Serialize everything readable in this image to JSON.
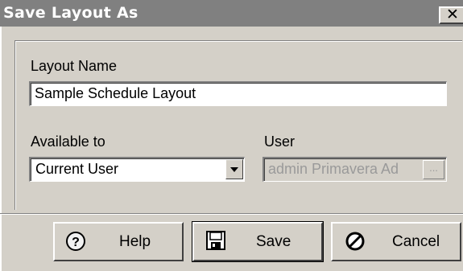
{
  "dialog": {
    "title": "Save Layout As",
    "close_glyph": "✕"
  },
  "form": {
    "layout_name_label": "Layout Name",
    "layout_name_value": "Sample Schedule Layout",
    "available_to_label": "Available to",
    "available_to_value": "Current User",
    "user_label": "User",
    "user_value": "admin  Primavera Ad",
    "user_browse_label": "..."
  },
  "buttons": {
    "help": {
      "label": "Help",
      "icon": "help-icon"
    },
    "save": {
      "label": "Save",
      "icon": "floppy-disk-icon"
    },
    "cancel": {
      "label": "Cancel",
      "icon": "cancel-icon"
    }
  },
  "colors": {
    "title_bar": "#808080",
    "dialog_face": "#d4d0c8",
    "disabled_text": "#9a9a9a"
  }
}
